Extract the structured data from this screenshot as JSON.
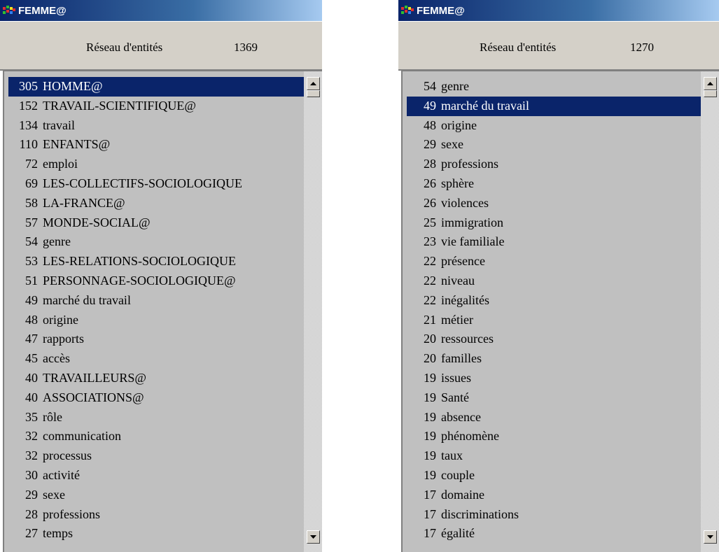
{
  "colors": {
    "title_bar": "#0a246a",
    "selection": "#0a246a",
    "panel": "#d4d0c8",
    "list_bg": "#c0c0c0"
  },
  "left": {
    "title": "FEMME@",
    "header": {
      "label": "Réseau d'entités",
      "count": "1369"
    },
    "selected_index": 0,
    "items": [
      {
        "count": "305",
        "label": "HOMME@"
      },
      {
        "count": "152",
        "label": "TRAVAIL-SCIENTIFIQUE@"
      },
      {
        "count": "134",
        "label": "travail"
      },
      {
        "count": "110",
        "label": "ENFANTS@"
      },
      {
        "count": "72",
        "label": "emploi"
      },
      {
        "count": "69",
        "label": "LES-COLLECTIFS-SOCIOLOGIQUE"
      },
      {
        "count": "58",
        "label": "LA-FRANCE@"
      },
      {
        "count": "57",
        "label": "MONDE-SOCIAL@"
      },
      {
        "count": "54",
        "label": "genre"
      },
      {
        "count": "53",
        "label": "LES-RELATIONS-SOCIOLOGIQUE"
      },
      {
        "count": "51",
        "label": "PERSONNAGE-SOCIOLOGIQUE@"
      },
      {
        "count": "49",
        "label": "marché du travail"
      },
      {
        "count": "48",
        "label": "origine"
      },
      {
        "count": "47",
        "label": "rapports"
      },
      {
        "count": "45",
        "label": "accès"
      },
      {
        "count": "40",
        "label": "TRAVAILLEURS@"
      },
      {
        "count": "40",
        "label": "ASSOCIATIONS@"
      },
      {
        "count": "35",
        "label": "rôle"
      },
      {
        "count": "32",
        "label": "communication"
      },
      {
        "count": "32",
        "label": "processus"
      },
      {
        "count": "30",
        "label": "activité"
      },
      {
        "count": "29",
        "label": "sexe"
      },
      {
        "count": "28",
        "label": "professions"
      },
      {
        "count": "27",
        "label": "temps"
      }
    ]
  },
  "right": {
    "title": "FEMME@",
    "header": {
      "label": "Réseau d'entités",
      "count": "1270"
    },
    "selected_index": 1,
    "items": [
      {
        "count": "54",
        "label": "genre"
      },
      {
        "count": "49",
        "label": "marché du travail"
      },
      {
        "count": "48",
        "label": "origine"
      },
      {
        "count": "29",
        "label": "sexe"
      },
      {
        "count": "28",
        "label": "professions"
      },
      {
        "count": "26",
        "label": "sphère"
      },
      {
        "count": "26",
        "label": "violences"
      },
      {
        "count": "25",
        "label": "immigration"
      },
      {
        "count": "23",
        "label": "vie familiale"
      },
      {
        "count": "22",
        "label": "présence"
      },
      {
        "count": "22",
        "label": "niveau"
      },
      {
        "count": "22",
        "label": "inégalités"
      },
      {
        "count": "21",
        "label": "métier"
      },
      {
        "count": "20",
        "label": "ressources"
      },
      {
        "count": "20",
        "label": "familles"
      },
      {
        "count": "19",
        "label": "issues"
      },
      {
        "count": "19",
        "label": "Santé"
      },
      {
        "count": "19",
        "label": "absence"
      },
      {
        "count": "19",
        "label": "phénomène"
      },
      {
        "count": "19",
        "label": "taux"
      },
      {
        "count": "19",
        "label": "couple"
      },
      {
        "count": "17",
        "label": "domaine"
      },
      {
        "count": "17",
        "label": "discriminations"
      },
      {
        "count": "17",
        "label": "égalité"
      }
    ]
  }
}
